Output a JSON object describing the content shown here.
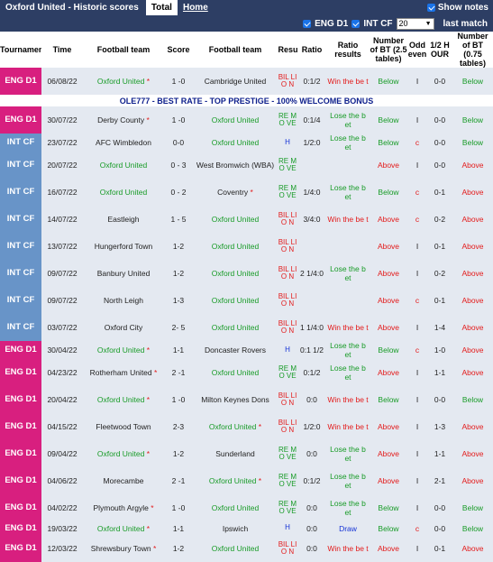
{
  "header": {
    "title": "Oxford United - Historic scores",
    "tab_total": "Total",
    "tab_home": "Home",
    "show_notes": "Show notes"
  },
  "filters": {
    "eng_d1": "ENG D1",
    "int_cf": "INT CF",
    "count": "20",
    "last_match": "last match"
  },
  "columns": [
    "Tournaments",
    "Time",
    "Football team",
    "Score",
    "Football team",
    "Result",
    "Ratio",
    "Ratio results",
    "Number of BT (2.5 tables)",
    "Odd even",
    "1/2 H OUR",
    "Number of BT (0.75 tables)"
  ],
  "colors": {
    "eng_d1": "#d81f7f",
    "int_cf": "#6894c8",
    "ours": "#179b26",
    "red": "#e31b1b"
  },
  "ad": "OLE777 - BEST RATE - TOP PRESTIGE - 100% WELCOME BONUS",
  "rows": [
    {
      "tour": "ENG D1",
      "time": "06/08/22",
      "home": "Oxford United",
      "hstar": "*",
      "score": "1 -0",
      "away": "Cambridge United",
      "astar": "",
      "result": "BIL LIO N",
      "ratio": "0:1/2",
      "rr": "Win the be t",
      "rrc": "win",
      "bt": "Below",
      "oe": "I",
      "h": "0-0",
      "bt2": "Below",
      "oxhome": true
    },
    {
      "ad": true
    },
    {
      "tour": "ENG D1",
      "time": "30/07/22",
      "home": "Derby County",
      "hstar": "*",
      "score": "1 -0",
      "away": "Oxford United",
      "astar": "",
      "result": "RE MO VE",
      "ratio": "0:1/4",
      "rr": "Lose the b et",
      "rrc": "lose",
      "bt": "Below",
      "oe": "I",
      "h": "0-0",
      "bt2": "Below",
      "oxhome": false
    },
    {
      "tour": "INT CF",
      "time": "23/07/22",
      "home": "AFC Wimbledon",
      "hstar": "",
      "score": "0-0",
      "away": "Oxford United",
      "astar": "",
      "result": "H",
      "ratio": "1/2:0",
      "rr": "Lose the b et",
      "rrc": "lose",
      "bt": "Below",
      "oe": "c",
      "h": "0-0",
      "bt2": "Below",
      "oxhome": false,
      "short": true
    },
    {
      "tour": "INT CF",
      "time": "20/07/22",
      "home": "Oxford United",
      "hstar": "",
      "score": "0 - 3",
      "away": "West Bromwich (WBA)",
      "astar": "",
      "result": "RE MO VE",
      "ratio": "",
      "rr": "",
      "rrc": "",
      "bt": "Above",
      "oe": "I",
      "h": "0-0",
      "bt2": "Above",
      "oxhome": true
    },
    {
      "tour": "INT CF",
      "time": "16/07/22",
      "home": "Oxford United",
      "hstar": "",
      "score": "0 - 2",
      "away": "Coventry",
      "astar": "*",
      "result": "RE MO VE",
      "ratio": "1/4:0",
      "rr": "Lose the b et",
      "rrc": "lose",
      "bt": "Below",
      "oe": "c",
      "h": "0-1",
      "bt2": "Above",
      "oxhome": true
    },
    {
      "tour": "INT CF",
      "time": "14/07/22",
      "home": "Eastleigh",
      "hstar": "",
      "score": "1 - 5",
      "away": "Oxford United",
      "astar": "",
      "result": "BIL LIO N",
      "ratio": "3/4:0",
      "rr": "Win the be t",
      "rrc": "win",
      "bt": "Above",
      "oe": "c",
      "h": "0-2",
      "bt2": "Above",
      "oxhome": false
    },
    {
      "tour": "INT CF",
      "time": "13/07/22",
      "home": "Hungerford Town",
      "hstar": "",
      "score": "1-2",
      "away": "Oxford United",
      "astar": "",
      "result": "BIL LIO N",
      "ratio": "",
      "rr": "",
      "rrc": "",
      "bt": "Above",
      "oe": "I",
      "h": "0-1",
      "bt2": "Above",
      "oxhome": false
    },
    {
      "tour": "INT CF",
      "time": "09/07/22",
      "home": "Banbury United",
      "hstar": "",
      "score": "1-2",
      "away": "Oxford United",
      "astar": "",
      "result": "BIL LIO N",
      "ratio": "2 1/4:0",
      "rr": "Lose the b et",
      "rrc": "lose",
      "bt": "Above",
      "oe": "I",
      "h": "0-2",
      "bt2": "Above",
      "oxhome": false
    },
    {
      "tour": "INT CF",
      "time": "09/07/22",
      "home": "North Leigh",
      "hstar": "",
      "score": "1-3",
      "away": "Oxford United",
      "astar": "",
      "result": "BIL LIO N",
      "ratio": "",
      "rr": "",
      "rrc": "",
      "bt": "Above",
      "oe": "c",
      "h": "0-1",
      "bt2": "Above",
      "oxhome": false
    },
    {
      "tour": "INT CF",
      "time": "03/07/22",
      "home": "Oxford City",
      "hstar": "",
      "score": "2- 5",
      "away": "Oxford United",
      "astar": "",
      "result": "BIL LIO N",
      "ratio": "1 1/4:0",
      "rr": "Win the be t",
      "rrc": "win",
      "bt": "Above",
      "oe": "I",
      "h": "1-4",
      "bt2": "Above",
      "oxhome": false
    },
    {
      "tour": "ENG D1",
      "time": "30/04/22",
      "home": "Oxford United",
      "hstar": "*",
      "score": "1-1",
      "away": "Doncaster Rovers",
      "astar": "",
      "result": "H",
      "ratio": "0:1 1/2",
      "rr": "Lose the b et",
      "rrc": "lose",
      "bt": "Below",
      "oe": "c",
      "h": "1-0",
      "bt2": "Above",
      "oxhome": true,
      "short": true
    },
    {
      "tour": "ENG D1",
      "time": "04/23/22",
      "home": "Rotherham United",
      "hstar": "*",
      "score": "2 -1",
      "away": "Oxford United",
      "astar": "",
      "result": "RE MO VE",
      "ratio": "0:1/2",
      "rr": "Lose the b et",
      "rrc": "lose",
      "bt": "Above",
      "oe": "I",
      "h": "1-1",
      "bt2": "Above",
      "oxhome": false
    },
    {
      "tour": "ENG D1",
      "time": "20/04/22",
      "home": "Oxford United",
      "hstar": "*",
      "score": "1 -0",
      "away": "Milton Keynes Dons",
      "astar": "",
      "result": "BIL LIO N",
      "ratio": "0:0",
      "rr": "Win the be t",
      "rrc": "win",
      "bt": "Below",
      "oe": "I",
      "h": "0-0",
      "bt2": "Below",
      "oxhome": true
    },
    {
      "tour": "ENG D1",
      "time": "04/15/22",
      "home": "Fleetwood Town",
      "hstar": "",
      "score": "2-3",
      "away": "Oxford United",
      "astar": "*",
      "result": "BIL LIO N",
      "ratio": "1/2:0",
      "rr": "Win the be t",
      "rrc": "win",
      "bt": "Above",
      "oe": "I",
      "h": "1-3",
      "bt2": "Above",
      "oxhome": false
    },
    {
      "tour": "ENG D1",
      "time": "09/04/22",
      "home": "Oxford United",
      "hstar": "*",
      "score": "1-2",
      "away": "Sunderland",
      "astar": "",
      "result": "RE MO VE",
      "ratio": "0:0",
      "rr": "Lose the b et",
      "rrc": "lose",
      "bt": "Above",
      "oe": "I",
      "h": "1-1",
      "bt2": "Above",
      "oxhome": true
    },
    {
      "tour": "ENG D1",
      "time": "04/06/22",
      "home": "Morecambe",
      "hstar": "",
      "score": "2 -1",
      "away": "Oxford United",
      "astar": "*",
      "result": "RE MO VE",
      "ratio": "0:1/2",
      "rr": "Lose the b et",
      "rrc": "lose",
      "bt": "Above",
      "oe": "I",
      "h": "2-1",
      "bt2": "Above",
      "oxhome": false
    },
    {
      "tour": "ENG D1",
      "time": "04/02/22",
      "home": "Plymouth Argyle",
      "hstar": "*",
      "score": "1 -0",
      "away": "Oxford United",
      "astar": "",
      "result": "RE MO VE",
      "ratio": "0:0",
      "rr": "Lose the b et",
      "rrc": "lose",
      "bt": "Below",
      "oe": "I",
      "h": "0-0",
      "bt2": "Below",
      "oxhome": false
    },
    {
      "tour": "ENG D1",
      "time": "19/03/22",
      "home": "Oxford United",
      "hstar": "*",
      "score": "1-1",
      "away": "Ipswich",
      "astar": "",
      "result": "H",
      "ratio": "0:0",
      "rr": "Draw",
      "rrc": "draw",
      "bt": "Below",
      "oe": "c",
      "h": "0-0",
      "bt2": "Below",
      "oxhome": true,
      "short": true
    },
    {
      "tour": "ENG D1",
      "time": "12/03/22",
      "home": "Shrewsbury Town",
      "hstar": "*",
      "score": "1-2",
      "away": "Oxford United",
      "astar": "",
      "result": "BIL LIO N",
      "ratio": "0:0",
      "rr": "Win the be t",
      "rrc": "win",
      "bt": "Above",
      "oe": "I",
      "h": "0-1",
      "bt2": "Above",
      "oxhome": false
    }
  ]
}
